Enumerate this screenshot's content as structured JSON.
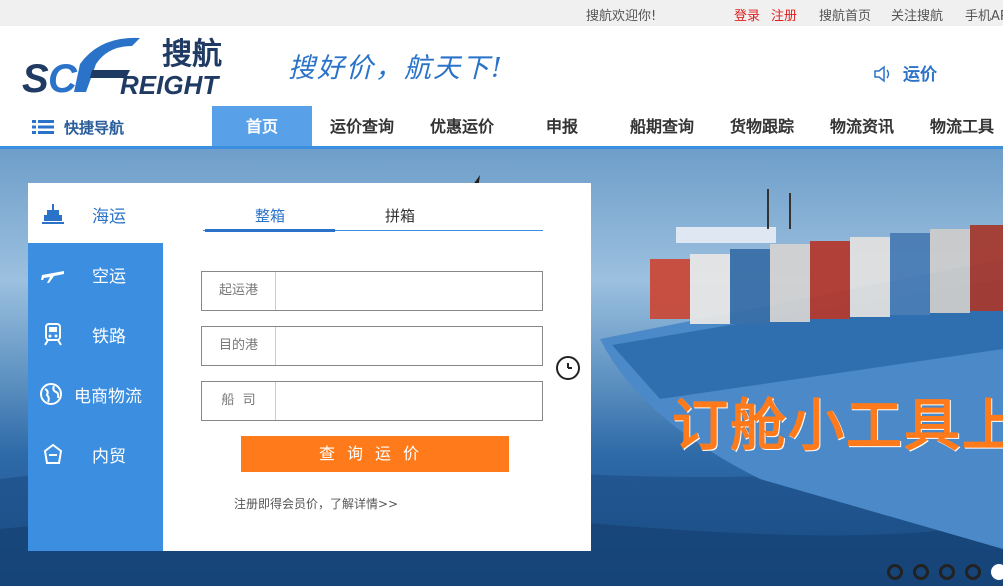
{
  "topbar": {
    "welcome": "搜航欢迎你!",
    "login": "登录",
    "register": "注册",
    "home": "搜航首页",
    "follow": "关注搜航",
    "mobile": "手机APP"
  },
  "header": {
    "logo_text": "SOFREIGHT",
    "logo_cn": "搜航",
    "slogan": "搜好价，航天下!",
    "yunjia": "运价"
  },
  "nav": {
    "quick_nav": "快捷导航",
    "items": [
      "首页",
      "运价查询",
      "优惠运价",
      "申报",
      "船期查询",
      "货物跟踪",
      "物流资讯",
      "物流工具"
    ]
  },
  "sidebar": {
    "items": [
      "海运",
      "空运",
      "铁路",
      "电商物流",
      "内贸"
    ]
  },
  "search": {
    "tabs": [
      "整箱",
      "拼箱"
    ],
    "origin_label": "起运港",
    "dest_label": "目的港",
    "carrier_label": "船  司",
    "origin_value": "",
    "dest_value": "",
    "carrier_value": "",
    "query_button": "查询运价",
    "register_tip": "注册即得会员价，了解详情>>"
  },
  "banner": {
    "promo": "订舱小工具上"
  },
  "colors": {
    "primary": "#3b8ee0",
    "accent": "#ff7a1a",
    "login_red": "#e02020"
  }
}
